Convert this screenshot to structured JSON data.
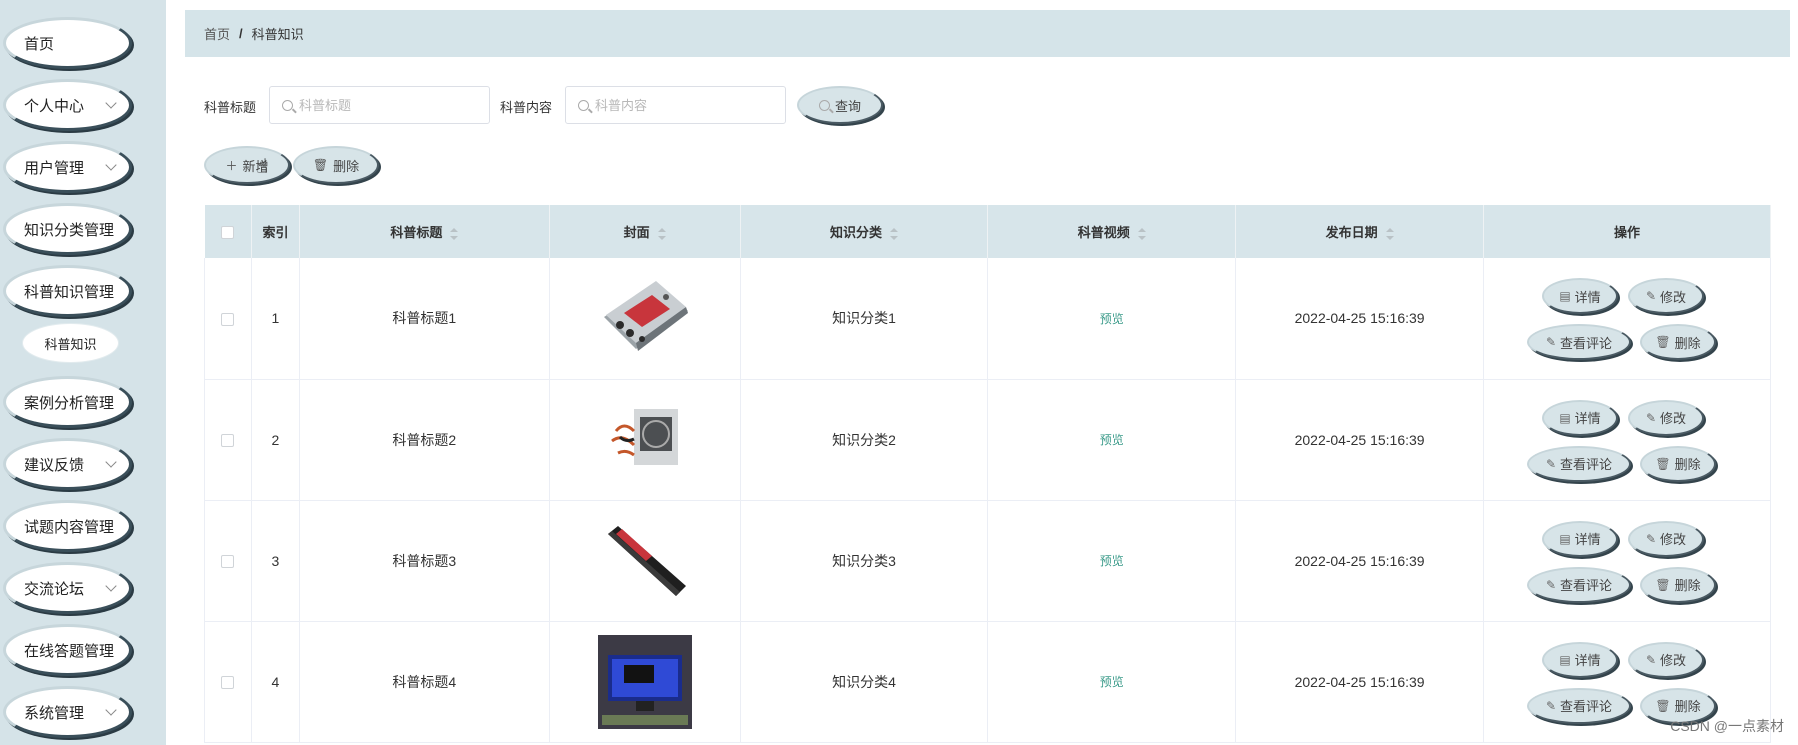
{
  "sidebar": {
    "items": [
      {
        "label": "首页",
        "has_children": false
      },
      {
        "label": "个人中心",
        "has_children": true
      },
      {
        "label": "用户管理",
        "has_children": true
      },
      {
        "label": "知识分类管理",
        "has_children": true
      },
      {
        "label": "科普知识管理",
        "has_children": false
      },
      {
        "label": "案例分析管理",
        "has_children": true
      },
      {
        "label": "建议反馈",
        "has_children": true
      },
      {
        "label": "试题内容管理",
        "has_children": true
      },
      {
        "label": "交流论坛",
        "has_children": true
      },
      {
        "label": "在线答题管理",
        "has_children": true
      },
      {
        "label": "系统管理",
        "has_children": true
      }
    ],
    "submenu_label": "科普知识"
  },
  "breadcrumb": {
    "home": "首页",
    "separator": "/",
    "current": "科普知识"
  },
  "search": {
    "title_label": "科普标题",
    "title_placeholder": "科普标题",
    "content_label": "科普内容",
    "content_placeholder": "科普内容",
    "query_button": "查询"
  },
  "toolbar": {
    "add_button": "新增",
    "delete_button": "删除"
  },
  "table": {
    "headers": {
      "index": "索引",
      "title": "科普标题",
      "cover": "封面",
      "category": "知识分类",
      "video": "科普视频",
      "date": "发布日期",
      "actions": "操作"
    },
    "rows": [
      {
        "index": "1",
        "title": "科普标题1",
        "cover": "hard-drive",
        "category": "知识分类1",
        "video": "预览",
        "date": "2022-04-25 15:16:39"
      },
      {
        "index": "2",
        "title": "科普标题2",
        "cover": "power-supply",
        "category": "知识分类2",
        "video": "预览",
        "date": "2022-04-25 15:16:39"
      },
      {
        "index": "3",
        "title": "科普标题3",
        "cover": "memory-stick",
        "category": "知识分类3",
        "video": "预览",
        "date": "2022-04-25 15:16:39"
      },
      {
        "index": "4",
        "title": "科普标题4",
        "cover": "computer-monitor",
        "category": "知识分类4",
        "video": "预览",
        "date": "2022-04-25 15:16:39"
      }
    ],
    "row_actions": {
      "detail": "详情",
      "edit": "修改",
      "comments": "查看评论",
      "delete": "删除"
    }
  },
  "watermark": "CSDN @一点素材",
  "colors": {
    "sidebar_bg": "#d5e3e8",
    "header_bg": "#d7e5ea",
    "preview_link": "#3b9b8a"
  }
}
